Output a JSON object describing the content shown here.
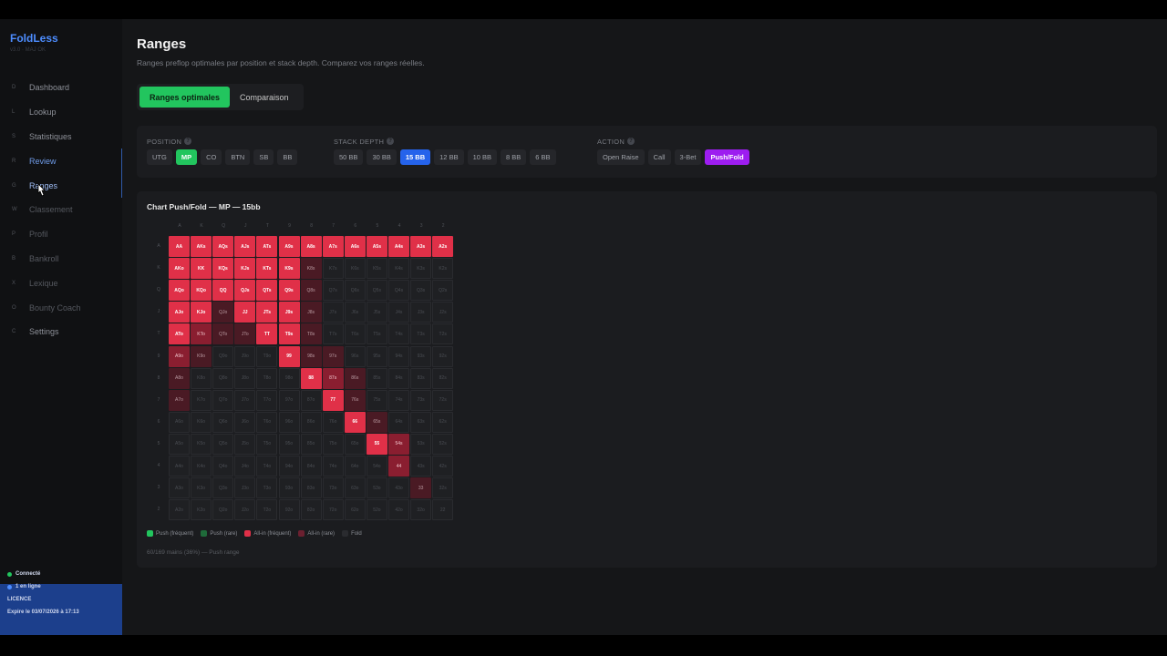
{
  "sidebar": {
    "brand": "FoldLess",
    "version": "v3.0 · MAJ OK",
    "items": [
      {
        "key": "D",
        "label": "Dashboard"
      },
      {
        "key": "L",
        "label": "Lookup"
      },
      {
        "key": "S",
        "label": "Statistiques"
      },
      {
        "key": "R",
        "label": "Review"
      },
      {
        "key": "G",
        "label": "Ranges"
      },
      {
        "key": "W",
        "label": "Classement"
      },
      {
        "key": "P",
        "label": "Profil"
      },
      {
        "key": "B",
        "label": "Bankroll"
      },
      {
        "key": "X",
        "label": "Lexique"
      },
      {
        "key": "O",
        "label": "Bounty Coach"
      },
      {
        "key": "C",
        "label": "Settings"
      }
    ],
    "status": {
      "connected": "Connecté",
      "online": "1 en ligne",
      "licence_label": "LICENCE",
      "licence_expiry": "Expire le 03/07/2026 à 17:13"
    }
  },
  "page": {
    "title": "Ranges",
    "subtitle": "Ranges preflop optimales par position et stack depth. Comparez vos ranges réelles.",
    "tabs": [
      "Ranges optimales",
      "Comparaison"
    ]
  },
  "filters": {
    "position_label": "POSITION",
    "positions": [
      "UTG",
      "MP",
      "CO",
      "BTN",
      "SB",
      "BB"
    ],
    "position_selected": "MP",
    "stack_label": "STACK DEPTH",
    "stacks": [
      "50 BB",
      "30 BB",
      "15 BB",
      "12 BB",
      "10 BB",
      "8 BB",
      "6 BB"
    ],
    "stack_selected": "15 BB",
    "action_label": "ACTION",
    "actions": [
      "Open Raise",
      "Call",
      "3-Bet",
      "Push/Fold"
    ],
    "action_selected": "Push/Fold",
    "help_glyph": "?"
  },
  "chart": {
    "title": "Chart Push/Fold — MP — 15bb",
    "ranks": [
      "A",
      "K",
      "Q",
      "J",
      "T",
      "9",
      "8",
      "7",
      "6",
      "5",
      "4",
      "3",
      "2"
    ],
    "grid": [
      [
        1,
        1,
        1,
        1,
        1,
        1,
        1,
        1,
        1,
        1,
        1,
        1,
        1
      ],
      [
        1,
        1,
        1,
        1,
        1,
        1,
        3,
        0,
        0,
        0,
        0,
        0,
        0
      ],
      [
        1,
        1,
        1,
        1,
        1,
        1,
        3,
        0,
        0,
        0,
        0,
        0,
        0
      ],
      [
        1,
        1,
        3,
        1,
        1,
        1,
        3,
        0,
        0,
        0,
        0,
        0,
        0
      ],
      [
        1,
        2,
        3,
        3,
        1,
        1,
        3,
        0,
        0,
        0,
        0,
        0,
        0
      ],
      [
        2,
        3,
        0,
        0,
        0,
        1,
        3,
        3,
        0,
        0,
        0,
        0,
        0
      ],
      [
        3,
        0,
        0,
        0,
        0,
        0,
        1,
        2,
        3,
        0,
        0,
        0,
        0
      ],
      [
        3,
        0,
        0,
        0,
        0,
        0,
        0,
        1,
        3,
        0,
        0,
        0,
        0
      ],
      [
        0,
        0,
        0,
        0,
        0,
        0,
        0,
        0,
        1,
        3,
        0,
        0,
        0
      ],
      [
        0,
        0,
        0,
        0,
        0,
        0,
        0,
        0,
        0,
        1,
        2,
        0,
        0
      ],
      [
        0,
        0,
        0,
        0,
        0,
        0,
        0,
        0,
        0,
        0,
        2,
        0,
        0
      ],
      [
        0,
        0,
        0,
        0,
        0,
        0,
        0,
        0,
        0,
        0,
        0,
        3,
        0
      ],
      [
        0,
        0,
        0,
        0,
        0,
        0,
        0,
        0,
        0,
        0,
        0,
        0,
        0
      ]
    ],
    "legend": [
      {
        "label": "Push (fréquent)",
        "color": "#22c55e"
      },
      {
        "label": "Push (rare)",
        "color": "#1f6b3a"
      },
      {
        "label": "All-in (fréquent)",
        "color": "#e03048"
      },
      {
        "label": "All-in (rare)",
        "color": "#6b2030"
      },
      {
        "label": "Fold",
        "color": "#2a2b2f"
      }
    ],
    "summary": "60/169 mains (36%) — Push range"
  }
}
